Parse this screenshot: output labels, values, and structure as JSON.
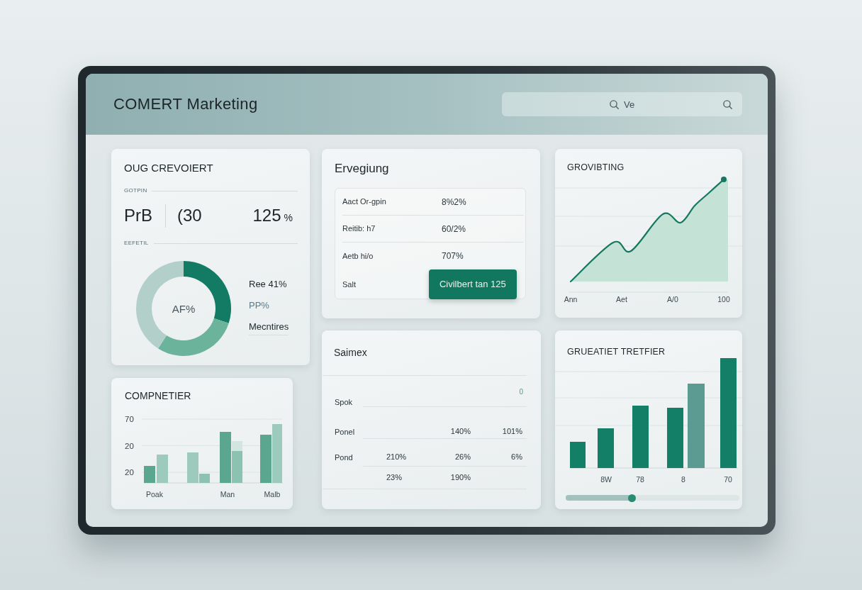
{
  "header": {
    "title": "COMERT Marketing",
    "search": {
      "placeholder": "Ve"
    }
  },
  "metrics_card": {
    "title": "OUG CREVOIERT",
    "metrics_label": "GOTPIN",
    "metrics": [
      {
        "value": "PrB"
      },
      {
        "value": "(30"
      },
      {
        "value": "125",
        "unit": "%"
      }
    ],
    "chart_label": "EEFETIL",
    "chart_data": {
      "type": "donut",
      "values": [
        30,
        29,
        41
      ],
      "colors": [
        "#137a64",
        "#6bb39b",
        "#b3cfca"
      ],
      "annotations": [
        "AF%"
      ]
    },
    "legend": [
      {
        "text": "Ree 41%",
        "muted": false
      },
      {
        "text": "PP%",
        "muted": true
      },
      {
        "text": "Mecntires",
        "muted": false
      }
    ]
  },
  "list_card": {
    "title": "Ervegiung",
    "rows": [
      {
        "label": "Aact Or-gpin",
        "value": "8%2%"
      },
      {
        "label": "Reitib: h7",
        "value": "60/2%"
      },
      {
        "label": "Aetb hi/o",
        "value": "707%"
      },
      {
        "label": "Salt",
        "button": "Civilbert tan 125"
      }
    ]
  },
  "area_chart_card": {
    "title": "GROVIBTING",
    "x_axis_labels": [
      "Ann",
      "Aet",
      "A/0",
      "100"
    ]
  },
  "grouped_bar_card": {
    "title": "COMPNETIER",
    "y_axis_labels": [
      "70",
      "20",
      "20"
    ],
    "x_axis_labels": [
      "Poak",
      "Man",
      "Malb"
    ]
  },
  "table_card": {
    "title": "Saimex",
    "note": "0",
    "rows": [
      {
        "label": "Spok"
      },
      {
        "label": "Ponel",
        "column_2": "140%",
        "column_3": "101%"
      },
      {
        "label": "Pond",
        "column_1": "210%",
        "column_2": "26%",
        "column_3": "6%"
      },
      {
        "column_1": "23%",
        "column_2": "190%"
      }
    ]
  },
  "bar_chart_card": {
    "title": "GRUEATIET TRETFIER",
    "x_axis_labels": [
      "8W",
      "78",
      "8",
      "70"
    ],
    "slider": {
      "level": 0.38
    }
  }
}
